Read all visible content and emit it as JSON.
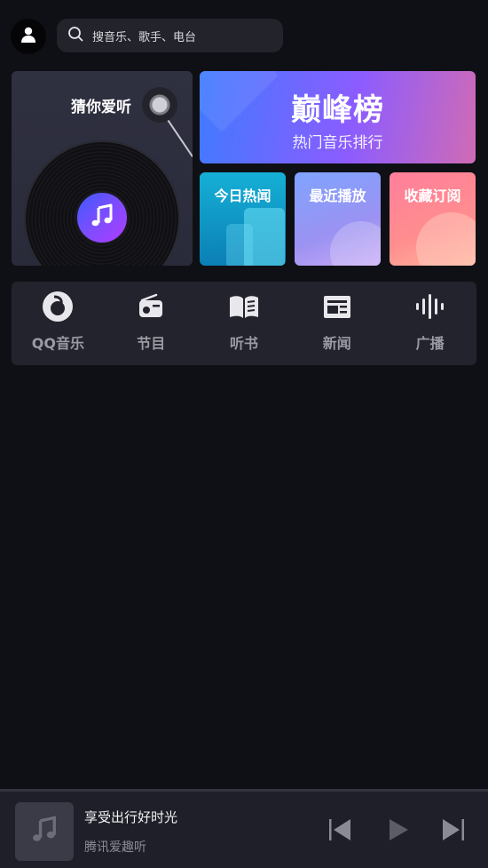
{
  "header": {
    "avatar_icon": "user-icon",
    "search": {
      "icon": "search-icon",
      "placeholder": "搜音乐、歌手、电台"
    }
  },
  "guess_card": {
    "title": "猜你爱听",
    "record_icon": "music-note-icon"
  },
  "rank_banner": {
    "logo_text": "巅峰榜",
    "subtitle": "热门音乐排行"
  },
  "quick_cards": [
    {
      "label": "今日热闻",
      "color": "#15b0d6"
    },
    {
      "label": "最近播放",
      "color": "#8f9af5"
    },
    {
      "label": "收藏订阅",
      "color": "#ff8a95"
    }
  ],
  "nav": [
    {
      "label": "QQ音乐",
      "icon": "qq-music-icon"
    },
    {
      "label": "节目",
      "icon": "radio-icon"
    },
    {
      "label": "听书",
      "icon": "book-icon"
    },
    {
      "label": "新闻",
      "icon": "news-icon"
    },
    {
      "label": "广播",
      "icon": "sound-wave-icon"
    }
  ],
  "player": {
    "song": "享受出行好时光",
    "artist": "腾讯爱趣听",
    "cover_icon": "music-note-icon"
  },
  "colors": {
    "background": "#0f1015",
    "card": "#22232c",
    "player_bg": "#1e1f28"
  }
}
